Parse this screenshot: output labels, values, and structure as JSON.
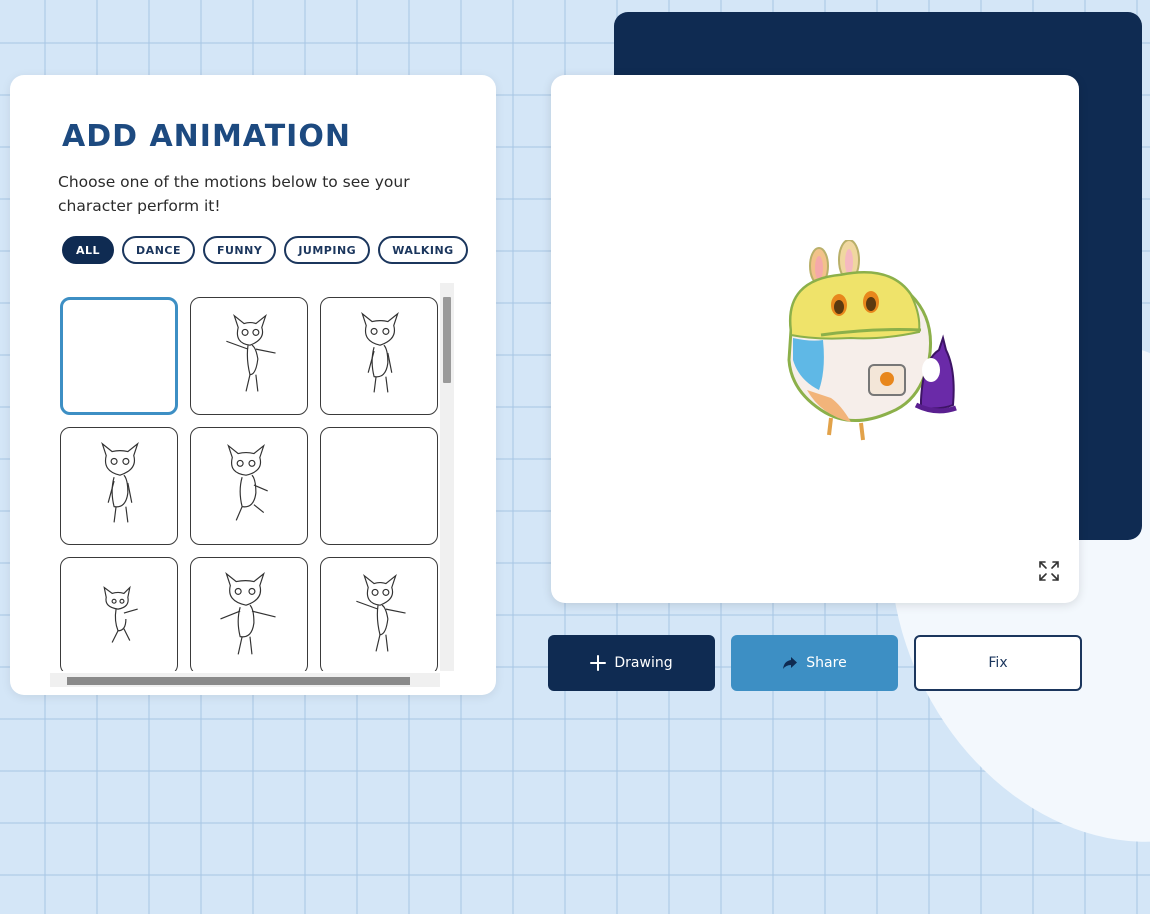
{
  "panel": {
    "title": "ADD ANIMATION",
    "description": "Choose one of the motions below to see your character perform it!"
  },
  "filters": [
    {
      "label": "ALL",
      "active": true
    },
    {
      "label": "DANCE",
      "active": false
    },
    {
      "label": "FUNNY",
      "active": false
    },
    {
      "label": "JUMPING",
      "active": false
    },
    {
      "label": "WALKING",
      "active": false
    }
  ],
  "motions": [
    {
      "pose": "blank",
      "selected": true
    },
    {
      "pose": "wave"
    },
    {
      "pose": "stand"
    },
    {
      "pose": "stand"
    },
    {
      "pose": "kick"
    },
    {
      "pose": "blank"
    },
    {
      "pose": "small"
    },
    {
      "pose": "wide"
    },
    {
      "pose": "wave"
    }
  ],
  "preview": {
    "expand_icon": "expand-icon"
  },
  "actions": {
    "drawing_label": "Drawing",
    "share_label": "Share",
    "fix_label": "Fix"
  },
  "colors": {
    "navy": "#0f2b52",
    "accent_blue": "#3d8fc4",
    "title_blue": "#1d4a80"
  }
}
